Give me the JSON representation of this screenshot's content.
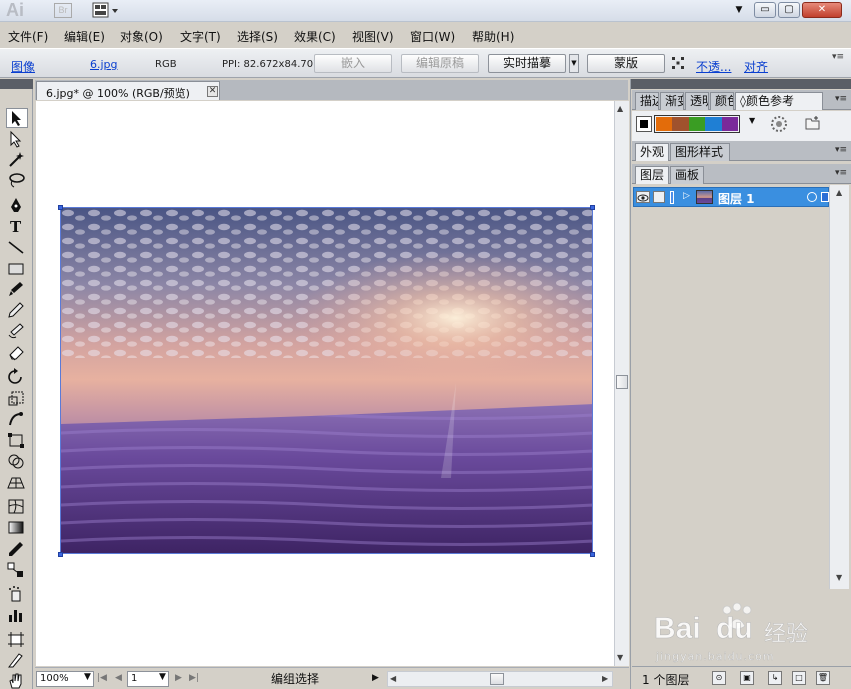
{
  "titlebar": {
    "app_logo": "Ai",
    "bridge_label": "Br",
    "workspace_icon": "layout-grid-icon",
    "dropdown_icon": "triangle-down-icon",
    "minimize": "▭",
    "maximize": "▢",
    "close": "✕"
  },
  "menubar": {
    "items": [
      "文件(F)",
      "编辑(E)",
      "对象(O)",
      "文字(T)",
      "选择(S)",
      "效果(C)",
      "视图(V)",
      "窗口(W)",
      "帮助(H)"
    ]
  },
  "controlbar": {
    "type_link": "图像",
    "file_link": "6.jpg",
    "color_mode": "RGB",
    "ppi": "PPI: 82.672x84.707",
    "embed": "嵌入",
    "edit_original": "编辑原稿",
    "live_trace": "实时描摹",
    "mask": "蒙版",
    "opacity_link": "不透...",
    "align_link": "对齐"
  },
  "document": {
    "tab_title": "6.jpg* @ 100% (RGB/预览)",
    "tab_close": "✕"
  },
  "statusbar": {
    "zoom": "100%",
    "page": "1",
    "status_text": "编组选择"
  },
  "panels": {
    "top_tabs": [
      "描边",
      "渐变",
      "透明",
      "颜色",
      "颜色参考"
    ],
    "appearance_tabs": [
      "外观",
      "图形样式"
    ],
    "layer_tabs": [
      "图层",
      "画板"
    ],
    "harmony_colors": [
      "#e36c0a",
      "#a0522d",
      "#3a9d23",
      "#1f7fd4",
      "#7a2a9a"
    ],
    "layer_name": "图层 1",
    "layer_count": "1 个图层"
  },
  "tools": [
    "selection-tool-icon",
    "direct-selection-tool-icon",
    "magic-wand-tool-icon",
    "lasso-tool-icon",
    "pen-tool-icon",
    "type-tool-icon",
    "line-tool-icon",
    "rectangle-tool-icon",
    "paintbrush-tool-icon",
    "pencil-tool-icon",
    "blob-brush-tool-icon",
    "eraser-tool-icon",
    "rotate-tool-icon",
    "scale-tool-icon",
    "warp-tool-icon",
    "free-transform-tool-icon",
    "shape-builder-tool-icon",
    "perspective-grid-tool-icon",
    "mesh-tool-icon",
    "gradient-tool-icon",
    "eyedropper-tool-icon",
    "blend-tool-icon",
    "symbol-sprayer-tool-icon",
    "column-graph-tool-icon",
    "artboard-tool-icon",
    "slice-tool-icon",
    "hand-tool-icon"
  ],
  "watermark": {
    "brand": "Bai",
    "brand_suffix": "du",
    "brand_cn": "经验",
    "url": "jingyan.baidu.com"
  }
}
